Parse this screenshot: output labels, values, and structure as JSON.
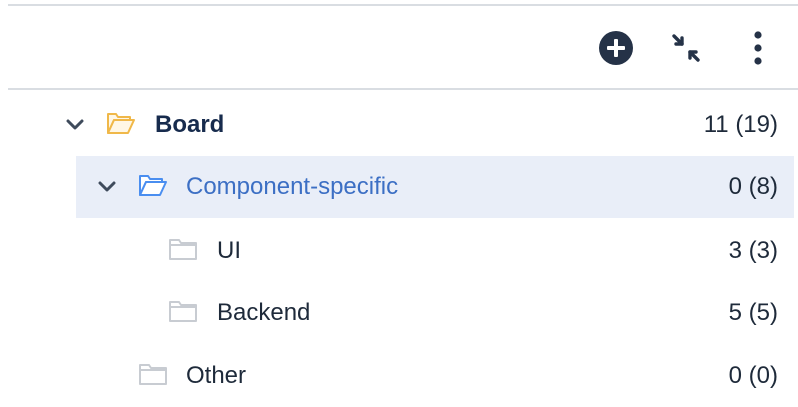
{
  "toolbar": {
    "add_icon": "plus-circle-icon",
    "collapse_icon": "collapse-arrows-icon",
    "more_icon": "vertical-ellipsis-icon"
  },
  "colors": {
    "root_folder": "#f0b849",
    "selected_folder": "#4a8ef0",
    "plain_folder": "#c8ccd2",
    "selected_bg": "#e9eef8",
    "selected_text": "#3c6fc4"
  },
  "tree": [
    {
      "label": "Board",
      "count": "11 (19)",
      "expanded": true
    },
    {
      "label": "Component-specific",
      "count": "0 (8)",
      "expanded": true,
      "selected": true
    },
    {
      "label": "UI",
      "count": "3 (3)"
    },
    {
      "label": "Backend",
      "count": "5 (5)"
    },
    {
      "label": "Other",
      "count": "0 (0)"
    }
  ]
}
